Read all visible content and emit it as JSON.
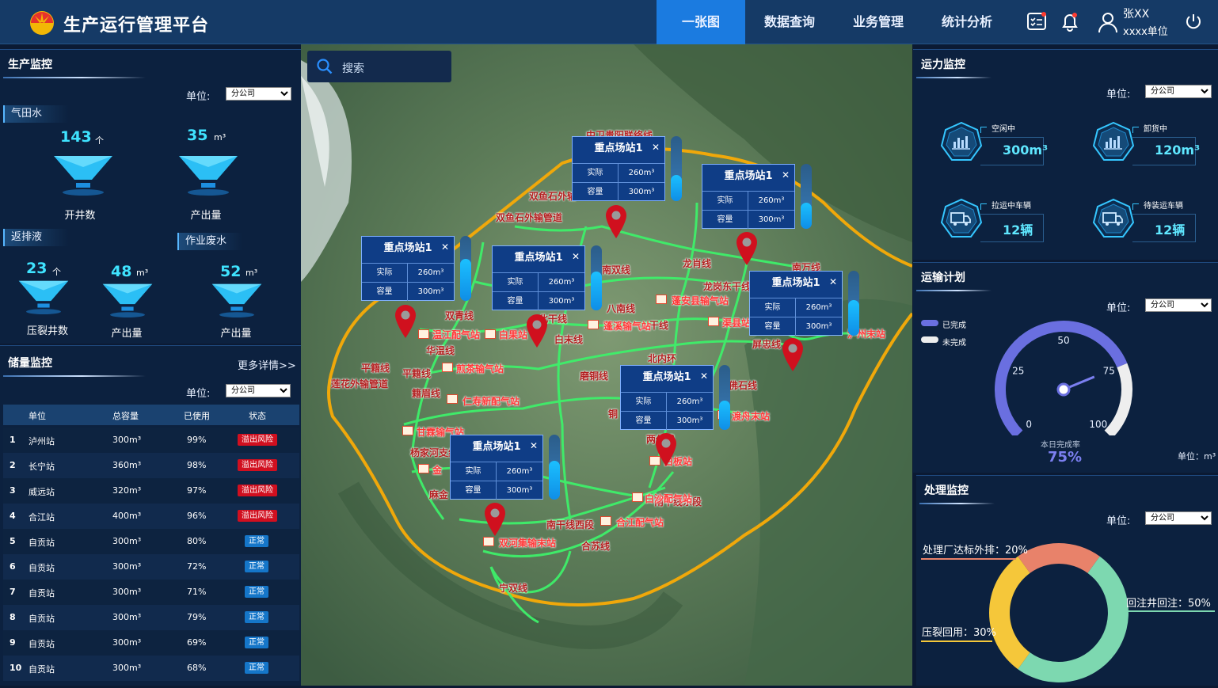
{
  "header": {
    "title": "生产运行管理平台",
    "nav": [
      "一张图",
      "数据查询",
      "业务管理",
      "统计分析"
    ],
    "active_nav": 0,
    "user": {
      "name": "张XX",
      "unit": "xxxx单位"
    }
  },
  "search": {
    "placeholder": "搜索"
  },
  "production": {
    "title": "生产监控",
    "unit_label": "单位:",
    "unit_value": "分公司",
    "gas_water": {
      "tag": "气田水",
      "metrics": [
        {
          "value": "143",
          "unit": "个",
          "label": "开井数"
        },
        {
          "value": "35",
          "unit": "m³",
          "label": "产出量"
        }
      ]
    },
    "flowback": {
      "tag": "返排液",
      "metrics": [
        {
          "value": "23",
          "unit": "个",
          "label": "压裂井数"
        },
        {
          "value": "48",
          "unit": "m³",
          "label": "产出量"
        }
      ]
    },
    "waste": {
      "tag": "作业废水",
      "metrics": [
        {
          "value": "52",
          "unit": "m³",
          "label": "产出量"
        }
      ]
    }
  },
  "storage": {
    "title": "储量监控",
    "more": "更多详情>>",
    "unit_label": "单位:",
    "unit_value": "分公司",
    "columns": [
      "单位",
      "总容量",
      "已使用",
      "状态"
    ],
    "rows": [
      {
        "no": "1",
        "unit": "泸州站",
        "cap": "300m³",
        "used": "99%",
        "status": "溢出风险",
        "risk": true
      },
      {
        "no": "2",
        "unit": "长宁站",
        "cap": "360m³",
        "used": "98%",
        "status": "溢出风险",
        "risk": true
      },
      {
        "no": "3",
        "unit": "威远站",
        "cap": "320m³",
        "used": "97%",
        "status": "溢出风险",
        "risk": true
      },
      {
        "no": "4",
        "unit": "合江站",
        "cap": "400m³",
        "used": "96%",
        "status": "溢出风险",
        "risk": true
      },
      {
        "no": "5",
        "unit": "自贡站",
        "cap": "300m³",
        "used": "80%",
        "status": "正常",
        "risk": false
      },
      {
        "no": "6",
        "unit": "自贡站",
        "cap": "300m³",
        "used": "72%",
        "status": "正常",
        "risk": false
      },
      {
        "no": "7",
        "unit": "自贡站",
        "cap": "300m³",
        "used": "71%",
        "status": "正常",
        "risk": false
      },
      {
        "no": "8",
        "unit": "自贡站",
        "cap": "300m³",
        "used": "79%",
        "status": "正常",
        "risk": false
      },
      {
        "no": "9",
        "unit": "自贡站",
        "cap": "300m³",
        "used": "69%",
        "status": "正常",
        "risk": false
      },
      {
        "no": "10",
        "unit": "自贡站",
        "cap": "300m³",
        "used": "68%",
        "status": "正常",
        "risk": false
      }
    ]
  },
  "map": {
    "popups": [
      {
        "title": "重点场站1",
        "actual_label": "实际",
        "actual": "260m³",
        "cap_label": "容量",
        "cap": "300m³",
        "fill": 0.4
      },
      {
        "title": "重点场站1",
        "actual_label": "实际",
        "actual": "260m³",
        "cap_label": "容量",
        "cap": "300m³",
        "fill": 0.4
      },
      {
        "title": "重点场站1",
        "actual_label": "实际",
        "actual": "260m³",
        "cap_label": "容量",
        "cap": "300m³",
        "fill": 0.65
      },
      {
        "title": "重点场站1",
        "actual_label": "实际",
        "actual": "260m³",
        "cap_label": "容量",
        "cap": "300m³",
        "fill": 0.6
      },
      {
        "title": "重点场站1",
        "actual_label": "实际",
        "actual": "260m³",
        "cap_label": "容量",
        "cap": "300m³",
        "fill": 0.55
      },
      {
        "title": "重点场站1",
        "actual_label": "实际",
        "actual": "260m³",
        "cap_label": "容量",
        "cap": "300m³",
        "fill": 0.45
      },
      {
        "title": "重点场站1",
        "actual_label": "实际",
        "actual": "260m³",
        "cap_label": "容量",
        "cap": "300m³",
        "fill": 0.6
      },
      {
        "title": "重点场站1",
        "actual_label": "实际",
        "actual": "260m³",
        "cap_label": "容量",
        "cap": "300m³",
        "fill": 0.55
      }
    ],
    "stations": [
      "温江配气站",
      "白果站",
      "蓬安县输气站",
      "渠县站",
      "蓬溪输气站",
      "煎茶输气站",
      "仁寿新配气站",
      "甘霖输气站",
      "白沙配气站",
      "合江配气站",
      "双河集输末站",
      "渡舟末站",
      "泸州末站",
      "白板站",
      "金"
    ],
    "lines": [
      "中卫贵阳联络线",
      "双鱼石外输",
      "双鱼石外输管道",
      "龙肖线",
      "南万线",
      "龙岗东干线",
      "双青线",
      "北干线",
      "八南线",
      "白末线",
      "北内环",
      "磨铜线",
      "华温线",
      "平籍线",
      "平籍线",
      "莲花外输管道",
      "籍眉线",
      "杨家河支线",
      "麻金",
      "南干线东段",
      "南干线西段",
      "合苏线",
      "宁双线",
      "屏忠线",
      "两代线",
      "佛石线",
      "南双线",
      "干线",
      "铜"
    ]
  },
  "transport": {
    "title": "运力监控",
    "unit_label": "单位:",
    "unit_value": "分公司",
    "cards": [
      {
        "label": "空闲中",
        "value": "300m³",
        "icon": "chart-icon"
      },
      {
        "label": "卸货中",
        "value": "120m³",
        "icon": "chart-icon"
      },
      {
        "label": "拉运中车辆",
        "value": "12辆",
        "icon": "truck-icon"
      },
      {
        "label": "待装运车辆",
        "value": "12辆",
        "icon": "truck-icon"
      }
    ]
  },
  "plan": {
    "title": "运输计划",
    "unit_label": "单位:",
    "unit_value": "分公司",
    "legend_done": "已完成",
    "legend_undone": "未完成",
    "ticks": [
      "0",
      "25",
      "50",
      "75",
      "100"
    ],
    "caption": "本日完成率",
    "rate_text": "75%",
    "rate": 75,
    "unit_note": "单位：m³",
    "colors": {
      "done": "#6a6fe0",
      "undone": "#eeeeee"
    }
  },
  "treatment": {
    "title": "处理监控",
    "unit_label": "单位:",
    "unit_value": "分公司",
    "chart_data": {
      "type": "pie",
      "labels": [
        "处理厂达标外排",
        "回注井回注",
        "压裂回用"
      ],
      "values": [
        20,
        50,
        30
      ],
      "colors": [
        "#e8826a",
        "#7dd8b0",
        "#f5c73a"
      ]
    },
    "label_texts": [
      "处理厂达标外排：20%",
      "回注井回注：50%",
      "压裂回用：30%"
    ]
  }
}
